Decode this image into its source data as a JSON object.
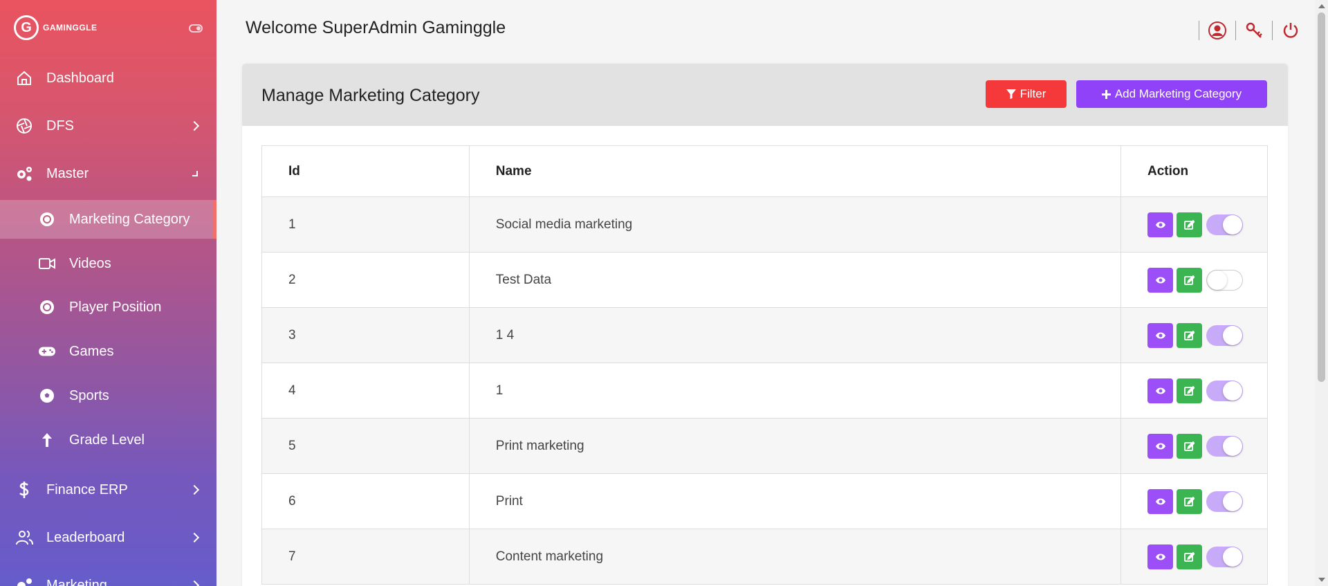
{
  "brand": {
    "logo_letter": "G",
    "name": "GAMINGGLE"
  },
  "sidebar": {
    "items": [
      {
        "label": "Dashboard",
        "icon": "home-icon"
      },
      {
        "label": "DFS",
        "icon": "aperture-icon"
      },
      {
        "label": "Master",
        "icon": "gears-icon"
      },
      {
        "label": "Finance ERP",
        "icon": "dollar-icon"
      },
      {
        "label": "Leaderboard",
        "icon": "users-icon"
      },
      {
        "label": "Marketing",
        "icon": "gears-icon"
      }
    ],
    "sub_items": [
      {
        "label": "Marketing Category",
        "icon": "badge-icon",
        "active": true
      },
      {
        "label": "Videos",
        "icon": "video-icon"
      },
      {
        "label": "Player Position",
        "icon": "badge-icon"
      },
      {
        "label": "Games",
        "icon": "gamepad-icon"
      },
      {
        "label": "Sports",
        "icon": "soccer-ball-icon"
      },
      {
        "label": "Grade Level",
        "icon": "arrow-up-icon"
      }
    ]
  },
  "header": {
    "welcome": "Welcome SuperAdmin Gaminggle"
  },
  "page": {
    "title": "Manage Marketing Category",
    "filter_label": "Filter",
    "add_label": "Add Marketing Category"
  },
  "table": {
    "columns": [
      "Id",
      "Name",
      "Action"
    ],
    "rows": [
      {
        "id": "1",
        "name": "Social media marketing",
        "active": true
      },
      {
        "id": "2",
        "name": "Test Data",
        "active": false
      },
      {
        "id": "3",
        "name": "1 4",
        "active": true
      },
      {
        "id": "4",
        "name": "1",
        "active": true
      },
      {
        "id": "5",
        "name": "Print marketing",
        "active": true
      },
      {
        "id": "6",
        "name": "Print",
        "active": true
      },
      {
        "id": "7",
        "name": "Content marketing",
        "active": true
      }
    ]
  },
  "colors": {
    "accent_purple": "#9042f8",
    "filter_red": "#f5393b",
    "edit_green": "#3bb552",
    "header_icon_red": "#c0282d"
  }
}
